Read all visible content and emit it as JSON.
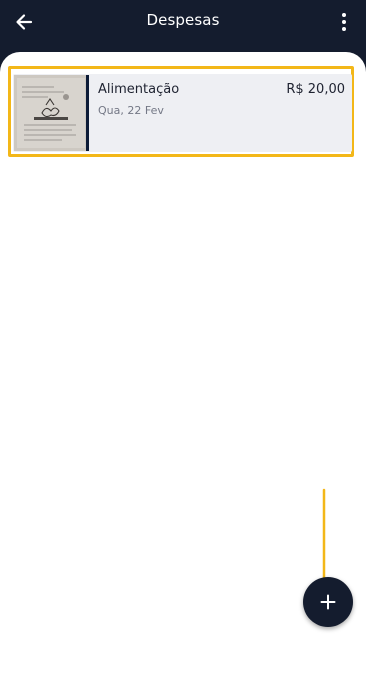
{
  "appbar": {
    "title": "Despesas",
    "back_icon": "arrow-left-icon",
    "menu_icon": "more-vertical-icon"
  },
  "expenses": [
    {
      "category": "Alimentação",
      "date": "Qua, 22 Fev",
      "amount": "R$ 20,00",
      "thumbnail": "receipt-photo"
    }
  ],
  "fab": {
    "icon": "plus-icon"
  },
  "colors": {
    "header_bg": "#141c2e",
    "card_bg": "#eeeff3",
    "highlight": "#f3b718",
    "text_primary": "#1e2230",
    "text_secondary": "#747886"
  }
}
